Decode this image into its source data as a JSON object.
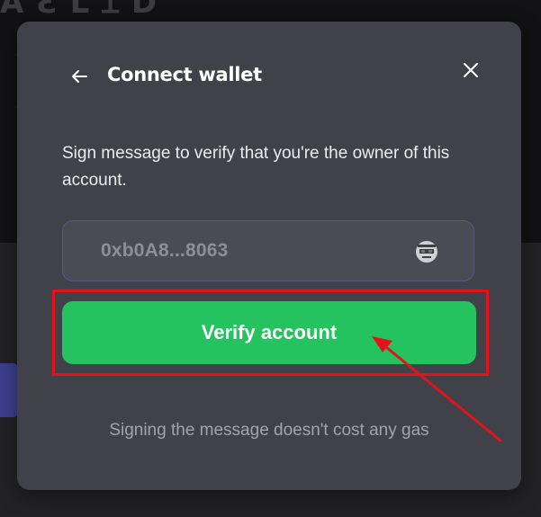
{
  "modal": {
    "title": "Connect wallet",
    "description": "Sign message to verify that you're the owner of this account.",
    "address": "0xb0A8...8063",
    "verify_label": "Verify account",
    "footnote": "Signing the message doesn't cost any gas"
  },
  "icons": {
    "back": "arrow-left-icon",
    "close": "close-icon",
    "avatar": "pixel-avatar-icon"
  },
  "colors": {
    "modal_bg": "#414249",
    "button_green": "#24c35f",
    "annotation_red": "#e3131b"
  }
}
